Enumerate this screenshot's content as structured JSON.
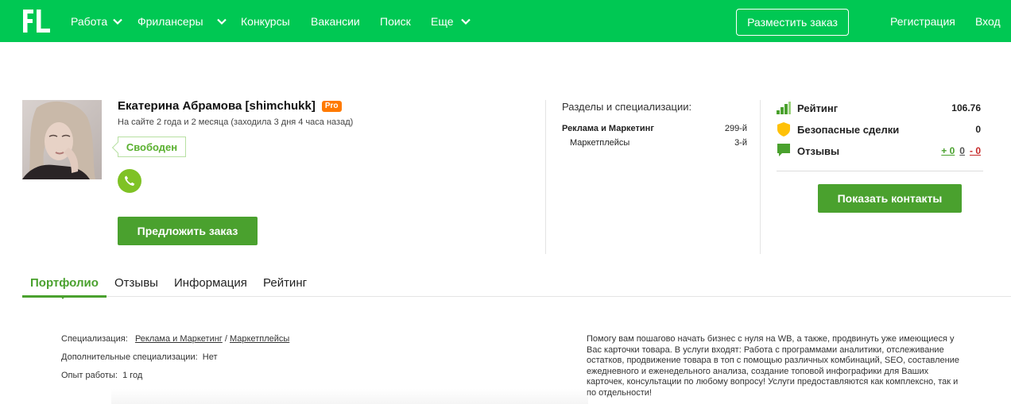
{
  "header": {
    "logo_text": "FL",
    "nav": [
      {
        "label": "Работа",
        "has_dropdown": true
      },
      {
        "label": "Фрилансеры",
        "has_dropdown": true
      },
      {
        "label": "Конкурсы",
        "has_dropdown": false
      },
      {
        "label": "Вакансии",
        "has_dropdown": false
      },
      {
        "label": "Поиск",
        "has_dropdown": false
      },
      {
        "label": "Еще",
        "has_dropdown": true
      }
    ],
    "post_order_label": "Разместить заказ",
    "register_label": "Регистрация",
    "login_label": "Вход",
    "brand_color": "#00c853"
  },
  "profile": {
    "name": "Екатерина Абрамова [shimchukk]",
    "pro_badge": "Pro",
    "site_time": "На сайте 2 года и 2 месяца (заходила 3 дня 4 часа назад)",
    "status": "Свободен",
    "offer_button": "Предложить заказ"
  },
  "sections": {
    "title": "Разделы и специализации:",
    "items": [
      {
        "name": "Реклама и Маркетинг",
        "rank": "299-й"
      },
      {
        "name": "Маркетплейсы",
        "rank": "3-й"
      }
    ]
  },
  "stats": {
    "rating_label": "Рейтинг",
    "rating_value": "106.76",
    "safe_deals_label": "Безопасные сделки",
    "safe_deals_value": "0",
    "reviews_label": "Отзывы",
    "reviews_positive": "+ 0",
    "reviews_neutral": "0",
    "reviews_negative": "- 0",
    "contacts_button": "Показать контакты"
  },
  "tabs": [
    {
      "label": "Портфолио",
      "active": true
    },
    {
      "label": "Отзывы",
      "active": false
    },
    {
      "label": "Информация",
      "active": false
    },
    {
      "label": "Рейтинг",
      "active": false
    }
  ],
  "info": {
    "spec_label": "Специализация:",
    "spec_main": "Реклама и Маркетинг",
    "spec_sep": "/",
    "spec_sub": "Маркетплейсы",
    "extra_label": "Дополнительные специализации:",
    "extra_value": "Нет",
    "exp_label": "Опыт работы:",
    "exp_value": "1 год",
    "description": "Помогу вам пошагово начать бизнес с нуля на WB, а также, продвинуть уже имеющиеся у Вас карточки товара. В услуги входят: Работа с программами аналитики, отслеживание остатков, продвижение товара в топ с помощью различных комбинаций, SEO, составление ежедневного и еженедельного анализа, создание топовой инфографики для Ваших карточек, консультации по любому вопросу! Услуги предоставляются как комплексно, так и по отдельности!"
  }
}
